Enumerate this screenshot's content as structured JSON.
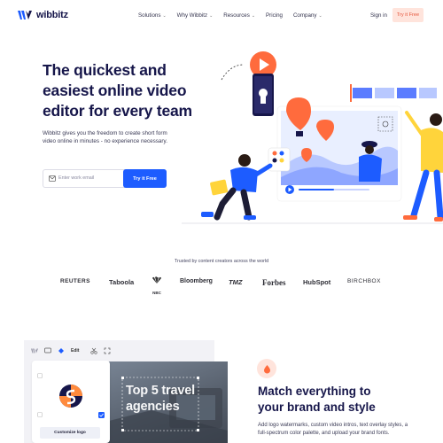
{
  "brand": {
    "name": "wibbitz",
    "accent": "#1d5cff",
    "orange": "#e5553b",
    "peach": "#ffe4dc"
  },
  "nav": {
    "links": [
      {
        "label": "Solutions",
        "dropdown": true
      },
      {
        "label": "Why Wibbitz",
        "dropdown": true
      },
      {
        "label": "Resources",
        "dropdown": true
      },
      {
        "label": "Pricing",
        "dropdown": false
      },
      {
        "label": "Company",
        "dropdown": true
      }
    ],
    "signin": "Sign in",
    "try_free": "Try it Free"
  },
  "hero": {
    "title_lines": [
      "The quickest and",
      "easiest online video",
      "editor for every team"
    ],
    "description": "Wibbitz gives you the freedom to create short form video online in minutes - no experience necessary.",
    "email_placeholder": "Enter work email",
    "cta": "Try it Free"
  },
  "trusted": {
    "label": "Trusted by content creators across the world",
    "logos": [
      "REUTERS",
      "Taboola",
      "NBC",
      "Bloomberg",
      "TMZ",
      "Forbes",
      "HubSpot",
      "BIRCHBOX"
    ]
  },
  "editor": {
    "edit_label": "Edit",
    "customize_label": "Customize logo",
    "overlay_lines": [
      "Top 5 travel",
      "agencies"
    ]
  },
  "feature": {
    "title_lines": [
      "Match everything to",
      "your brand and style"
    ],
    "description": "Add logo watermarks, custom video intros, text overlay styles, a full-spectrum color palette, and upload your brand fonts."
  }
}
